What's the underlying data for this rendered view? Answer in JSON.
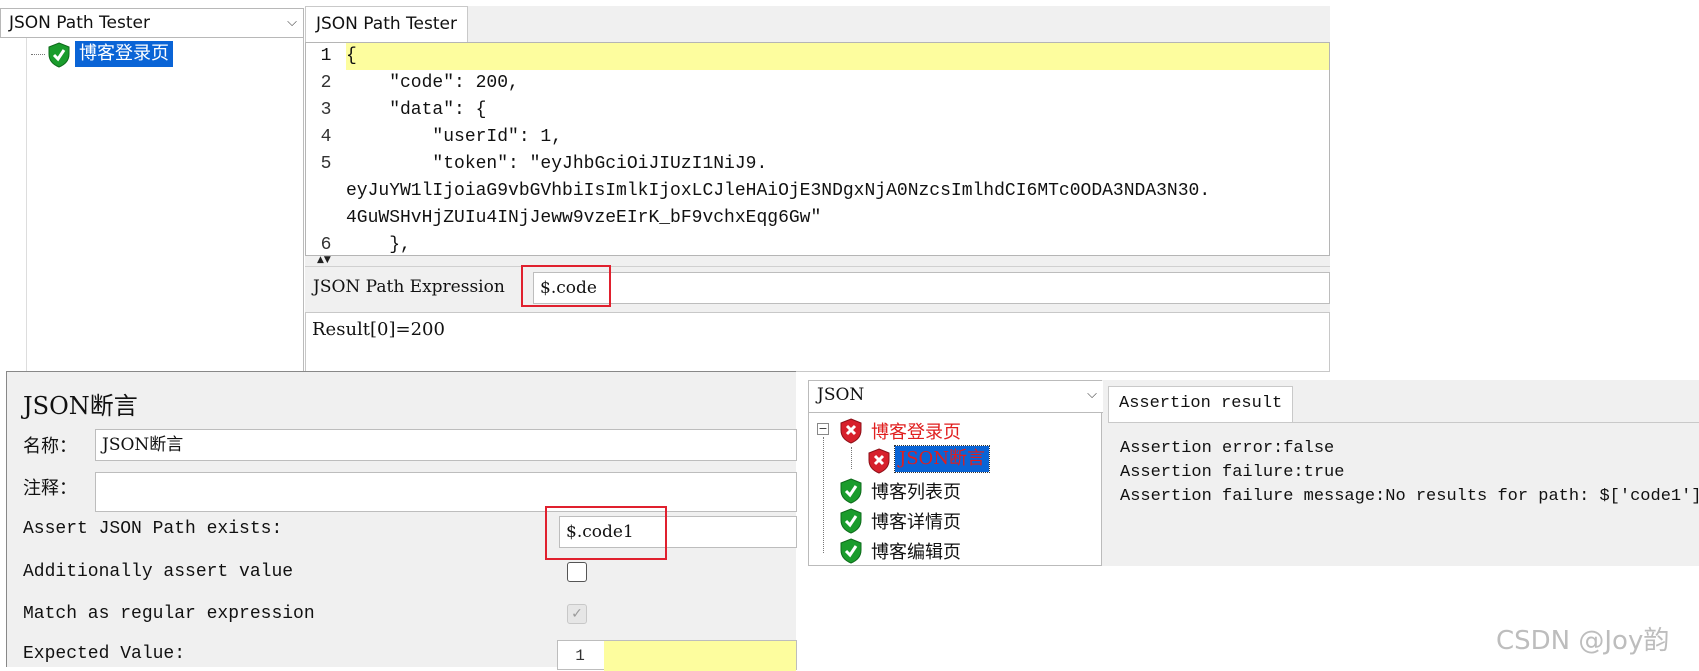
{
  "tester": {
    "combo_label": "JSON Path Tester",
    "tree_item": "博客登录页",
    "tab_label": "JSON Path Tester",
    "code_lines": [
      {
        "num": "1",
        "text": "{"
      },
      {
        "num": "2",
        "text": "    \"code\": 200,"
      },
      {
        "num": "3",
        "text": "    \"data\": {"
      },
      {
        "num": "4",
        "text": "        \"userId\": 1,"
      },
      {
        "num": "5",
        "text": "        \"token\": \"eyJhbGciOiJIUzI1NiJ9."
      },
      {
        "num": "",
        "text": "eyJuYW1lIjoiaG9vbGVhbiIsImlkIjoxLCJleHAiOjE3NDgxNjA0NzcsImlhdCI6MTc0ODA3NDA3N30."
      },
      {
        "num": "",
        "text": "4GuWSHvHjZUIu4INjJeww9vzeEIrK_bF9vchxEqg6Gw\""
      },
      {
        "num": "6",
        "text": "    },"
      }
    ],
    "expr_label": "JSON Path Expression",
    "expr_value": "$.code",
    "result": "Result[0]=200"
  },
  "assertion": {
    "title": "JSON断言",
    "name_label": "名称：",
    "name_value": "JSON断言",
    "comment_label": "注释：",
    "comment_value": "",
    "path_label": "Assert JSON Path exists:",
    "path_value": "$.code1",
    "assert_value_label": "Additionally assert value",
    "assert_value_checked": false,
    "regex_label": "Match as regular expression",
    "regex_checked": true,
    "expected_label": "Expected Value:",
    "expected_line_num": "1"
  },
  "results": {
    "combo_label": "JSON",
    "tree": [
      {
        "label": "博客登录页",
        "status": "error",
        "level": 0
      },
      {
        "label": "JSON断言",
        "status": "error",
        "level": 1,
        "selected": true
      },
      {
        "label": "博客列表页",
        "status": "ok",
        "level": 0
      },
      {
        "label": "博客详情页",
        "status": "ok",
        "level": 0
      },
      {
        "label": "博客编辑页",
        "status": "ok",
        "level": 0
      }
    ],
    "tab_label": "Assertion result",
    "lines": [
      "Assertion error:false",
      "Assertion failure:true",
      "Assertion failure message:No results for path: $['code1']"
    ]
  },
  "watermark": "CSDN @Joy韵",
  "colors": {
    "highlight": "#fdfd9e",
    "selection": "#0a64d6",
    "red_box": "#e0202e",
    "error_text": "#e01e1e",
    "ok_icon": "#1a9c2c",
    "error_icon": "#d7202c"
  }
}
